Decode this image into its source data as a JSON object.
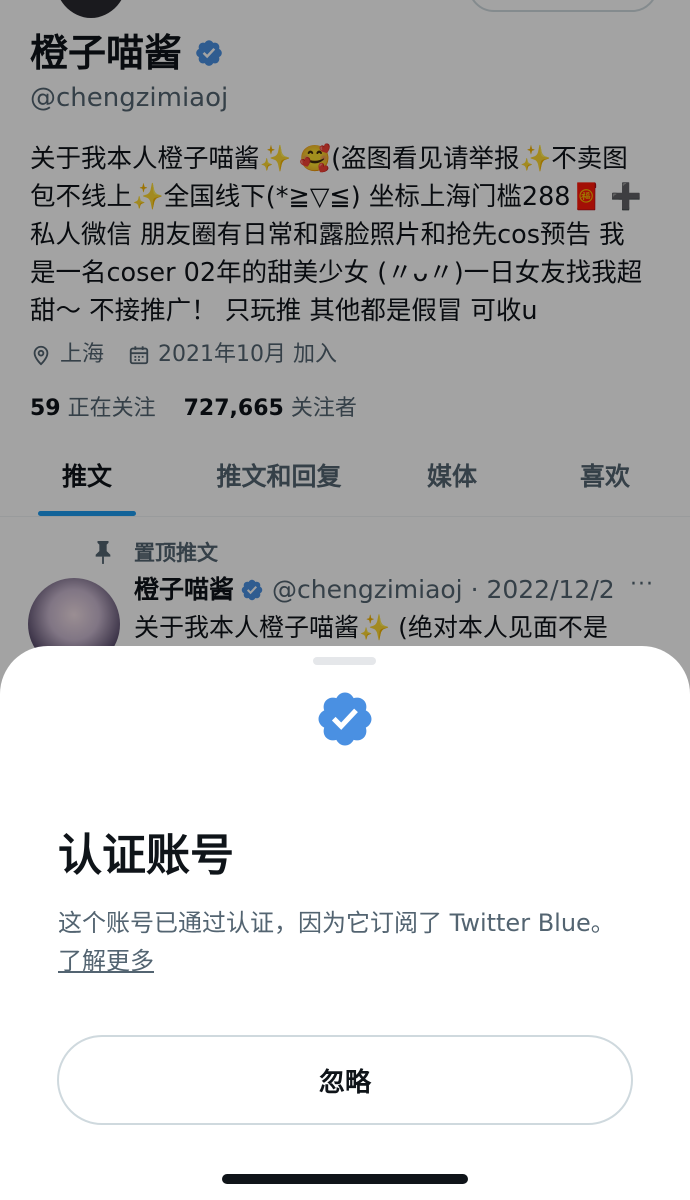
{
  "profile": {
    "name": "橙子喵酱",
    "handle": "@chengzimiaoj",
    "bio": "关于我本人橙子喵酱✨ 🥰(盗图看见请举报✨不卖图\n包不线上✨全国线下(*≧▽≦) 坐标上海门槛288🧧 ➕\n私人微信 朋友圈有日常和露脸照片和抢先cos预告 我\n是一名coser 02年的甜美少女 (〃ᴗ〃)一日女友找我超\n甜～ 不接推广！ 只玩推 其他都是假冒 可收u",
    "location": "上海",
    "joined": "2021年10月 加入",
    "following_count": "59",
    "following_label": "正在关注",
    "followers_count": "727,665",
    "followers_label": "关注者"
  },
  "tabs": [
    {
      "label": "推文"
    },
    {
      "label": "推文和回复"
    },
    {
      "label": "媒体"
    },
    {
      "label": "喜欢"
    }
  ],
  "pinned_post": {
    "pinned_label": "置顶推文",
    "name": "橙子喵酱",
    "handle_date": "@chengzimiaoj · 2022/12/2",
    "text": "关于我本人橙子喵酱✨ (绝对本人见面不是",
    "more": "···"
  },
  "sheet": {
    "title": "认证账号",
    "description": "这个账号已通过认证，因为它订阅了 Twitter Blue。",
    "link": "了解更多",
    "ignore_label": "忽略"
  },
  "colors": {
    "accent": "#1d9bf0",
    "badge": "#4a90e2",
    "text_secondary": "#536471"
  }
}
